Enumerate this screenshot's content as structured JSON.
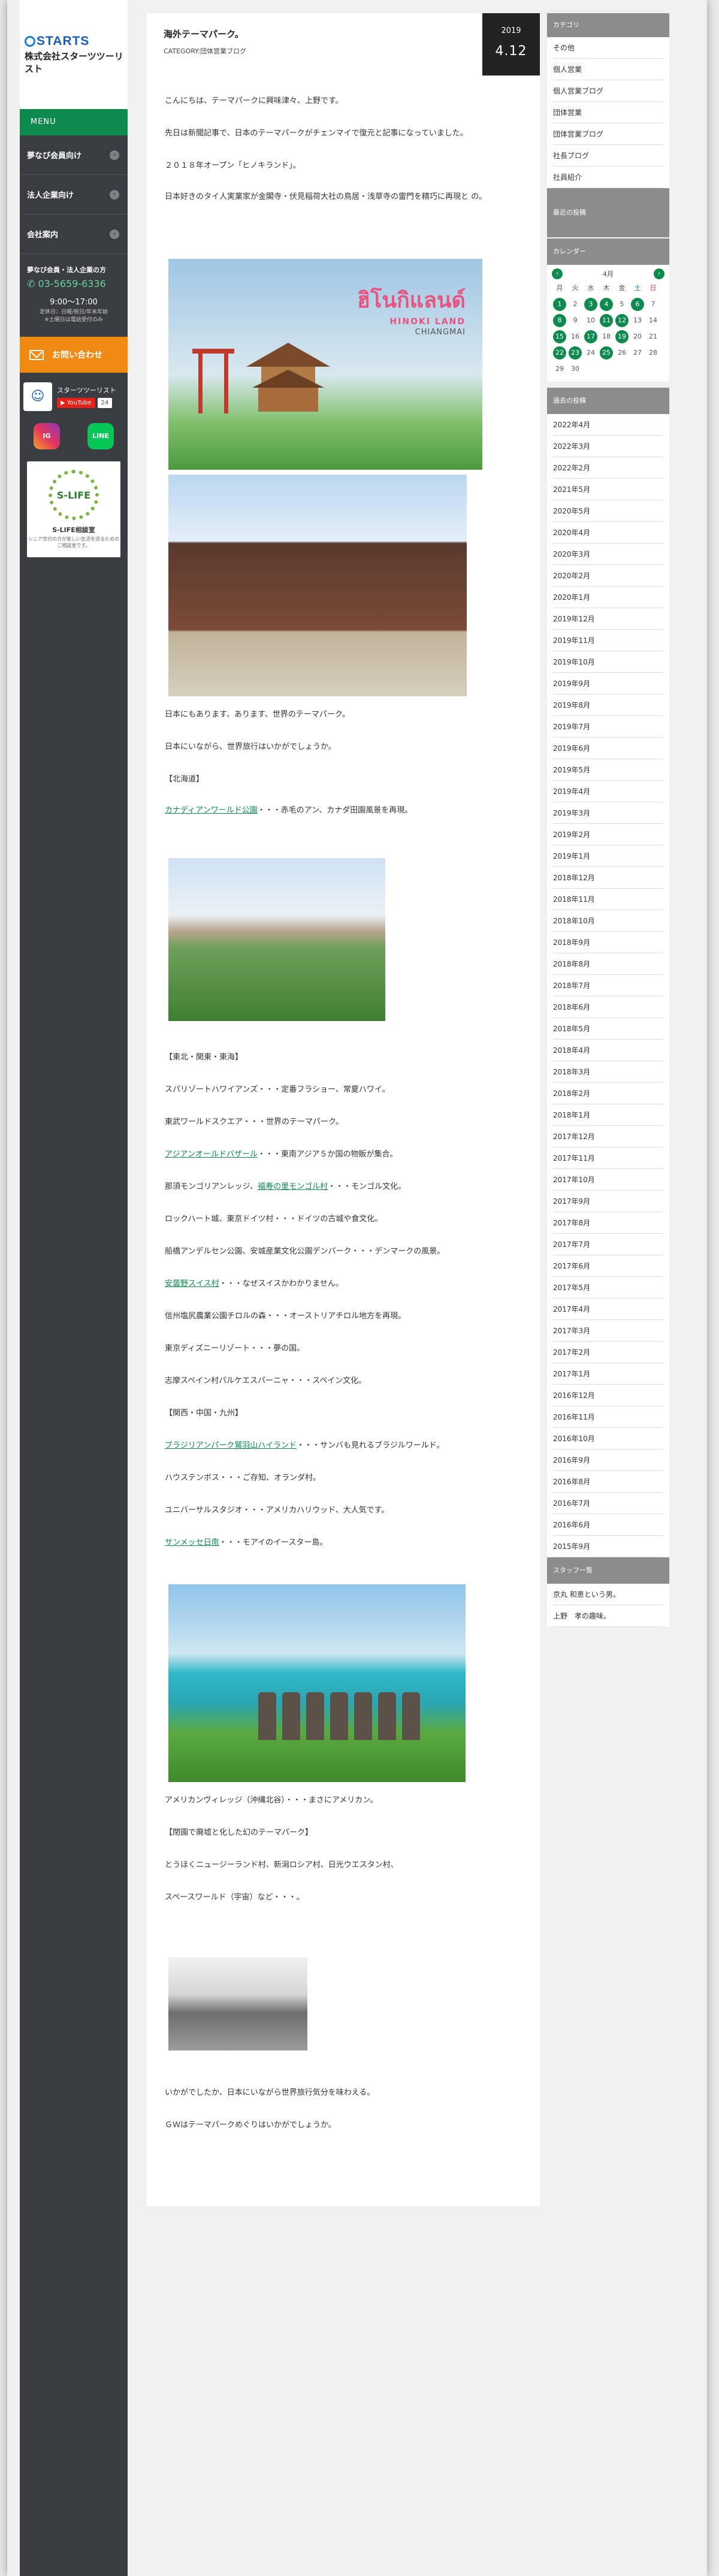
{
  "brand": {
    "logo_name": "STARTS",
    "logo_company": "株式会社スターツツーリスト"
  },
  "sidebar": {
    "menu_label": "MENU",
    "nav": [
      {
        "label": "夢なび会員向け"
      },
      {
        "label": "法人企業向け"
      },
      {
        "label": "会社案内"
      }
    ],
    "contact": {
      "heading": "夢なび会員・法人企業の方",
      "phone": "03-5659-6336",
      "hours": "9:00〜17:00",
      "note": "定休日：日曜/祝日/年末年始\n※土曜日は電話受付のみ"
    },
    "inquiry_label": "お問い合わせ",
    "social_title": "スターツツーリスト",
    "youtube_label": "YouTube",
    "youtube_count": "24",
    "instagram_label": "IG",
    "line_label": "LINE",
    "slife": {
      "badge": "S-LIFE",
      "name": "S-LIFE相談室",
      "desc": "シニア世代の方が楽しい生活を送るための\nご相談室です。"
    }
  },
  "post": {
    "year": "2019",
    "date": "4.12",
    "title": "海外テーマパーク。",
    "category": "CATEGORY:団体営業ブログ",
    "paragraphs": [
      "こんにちは、テーマパークに興味津々、上野です。",
      "先日は新聞記事で、日本のテーマパークがチェンマイで復元と記事になっていました。",
      "２０１８年オープン「ヒノキランド」。",
      "日本好きのタイ人実業家が金閣寺・伏見稲荷大社の鳥居・浅草寺の雷門を精巧に再現と の。"
    ],
    "image1": {
      "thai": "ฮิโนกิแลนด์",
      "en": "HINOKI LAND",
      "city": "CHIANGMAI"
    },
    "after_images": [
      "日本にもあります、あります、世界のテーマパーク。",
      "日本にいながら、世界旅行はいかがでしょうか。",
      "【北海道】"
    ],
    "hokkaido": {
      "link": "カナディアンワールド公園",
      "rest": "・・・赤毛のアン、カナダ田園風景を再現。"
    },
    "section2_title": "【東北・関東・東海】",
    "section2": [
      {
        "text": "スパリゾートハワイアンズ・・・定番フラショー、常夏ハワイ。"
      },
      {
        "text": "東武ワールドスクエア・・・世界のテーマパーク。"
      },
      {
        "link": "アジアンオールドバザール",
        "rest": "・・・東南アジア５か国の物販が集合。"
      },
      {
        "pre": "那須モンゴリアンレッジ、",
        "link": "福寿の里モンゴル村",
        "rest": "・・・モンゴル文化。"
      },
      {
        "text": "ロックハート城、東京ドイツ村・・・ドイツの古城や食文化。"
      },
      {
        "text": "船橋アンデルセン公園、安城産業文化公園デンパーク・・・デンマークの風景。"
      },
      {
        "link": "安曇野スイス村",
        "rest": "・・・なぜスイスかわかりません。"
      },
      {
        "text": "信州塩尻農業公園チロルの森・・・オーストリアチロル地方を再現。"
      },
      {
        "text": "東京ディズニーリゾート・・・夢の国。"
      },
      {
        "text": "志摩スペイン村パルケエスパーニャ・・・スペイン文化。"
      }
    ],
    "section3_title": "【関西・中国・九州】",
    "section3": [
      {
        "link": "ブラジリアンパーク鷲羽山ハイランド",
        "rest": "・・・サンバも見れるブラジルワールド。"
      },
      {
        "text": "ハウステンボス・・・ご存知、オランダ村。"
      },
      {
        "text": "ユニバーサルスタジオ・・・アメリカハリウッド、大人気です。"
      },
      {
        "link": "サンメッセ日南",
        "rest": "・・・モアイのイースター島。"
      }
    ],
    "after_moai": [
      "アメリカンヴィレッジ（沖縄北谷）・・・まさにアメリカン。",
      "【閉園で廃墟と化した幻のテーマパーク】",
      "とうほくニュージーランド村、新潟ロシア村、日光ウエスタン村、",
      "スペースワールド（宇宙）など・・・。"
    ],
    "closing": [
      "いかがでしたか、日本にいながら世界旅行気分を味わえる。",
      "ＧＷはテーマパークめぐりはいかがでしょうか。"
    ]
  },
  "right_sidebar": {
    "category_title": "カテゴリ",
    "categories": [
      "その他",
      "個人営業",
      "個人営業ブログ",
      "団体営業",
      "団体営業ブログ",
      "社長ブログ",
      "社員紹介"
    ],
    "recent_title": "最近の投稿",
    "calendar_title": "カレンダー",
    "calendar": {
      "month": "4月",
      "weekdays": [
        "月",
        "火",
        "水",
        "木",
        "金",
        "土",
        "日"
      ],
      "days": [
        "1",
        "2",
        "3",
        "4",
        "5",
        "6",
        "7",
        "8",
        "9",
        "10",
        "11",
        "12",
        "13",
        "14",
        "15",
        "16",
        "17",
        "18",
        "19",
        "20",
        "21",
        "22",
        "23",
        "24",
        "25",
        "26",
        "27",
        "28",
        "29",
        "30"
      ],
      "highlighted": [
        "1",
        "3",
        "4",
        "6",
        "8",
        "11",
        "12",
        "15",
        "17",
        "19",
        "22",
        "23",
        "25"
      ]
    },
    "archive_title": "過去の投稿",
    "archives": [
      "2022年4月",
      "2022年3月",
      "2022年2月",
      "2021年5月",
      "2020年5月",
      "2020年4月",
      "2020年3月",
      "2020年2月",
      "2020年1月",
      "2019年12月",
      "2019年11月",
      "2019年10月",
      "2019年9月",
      "2019年8月",
      "2019年7月",
      "2019年6月",
      "2019年5月",
      "2019年4月",
      "2019年3月",
      "2019年2月",
      "2019年1月",
      "2018年12月",
      "2018年11月",
      "2018年10月",
      "2018年9月",
      "2018年8月",
      "2018年7月",
      "2018年6月",
      "2018年5月",
      "2018年4月",
      "2018年3月",
      "2018年2月",
      "2018年1月",
      "2017年12月",
      "2017年11月",
      "2017年10月",
      "2017年9月",
      "2017年8月",
      "2017年7月",
      "2017年6月",
      "2017年5月",
      "2017年4月",
      "2017年3月",
      "2017年2月",
      "2017年1月",
      "2016年12月",
      "2016年11月",
      "2016年10月",
      "2016年9月",
      "2016年8月",
      "2016年7月",
      "2016年6月",
      "2015年9月"
    ],
    "staff_title": "スタッフ一覧",
    "staff": [
      "京丸 和恵という男。",
      "上野　孝の趣味。"
    ]
  },
  "colors": {
    "accent_green": "#0f8a4f",
    "sidebar_dark": "#393d42",
    "inquiry_orange": "#f08a12"
  }
}
